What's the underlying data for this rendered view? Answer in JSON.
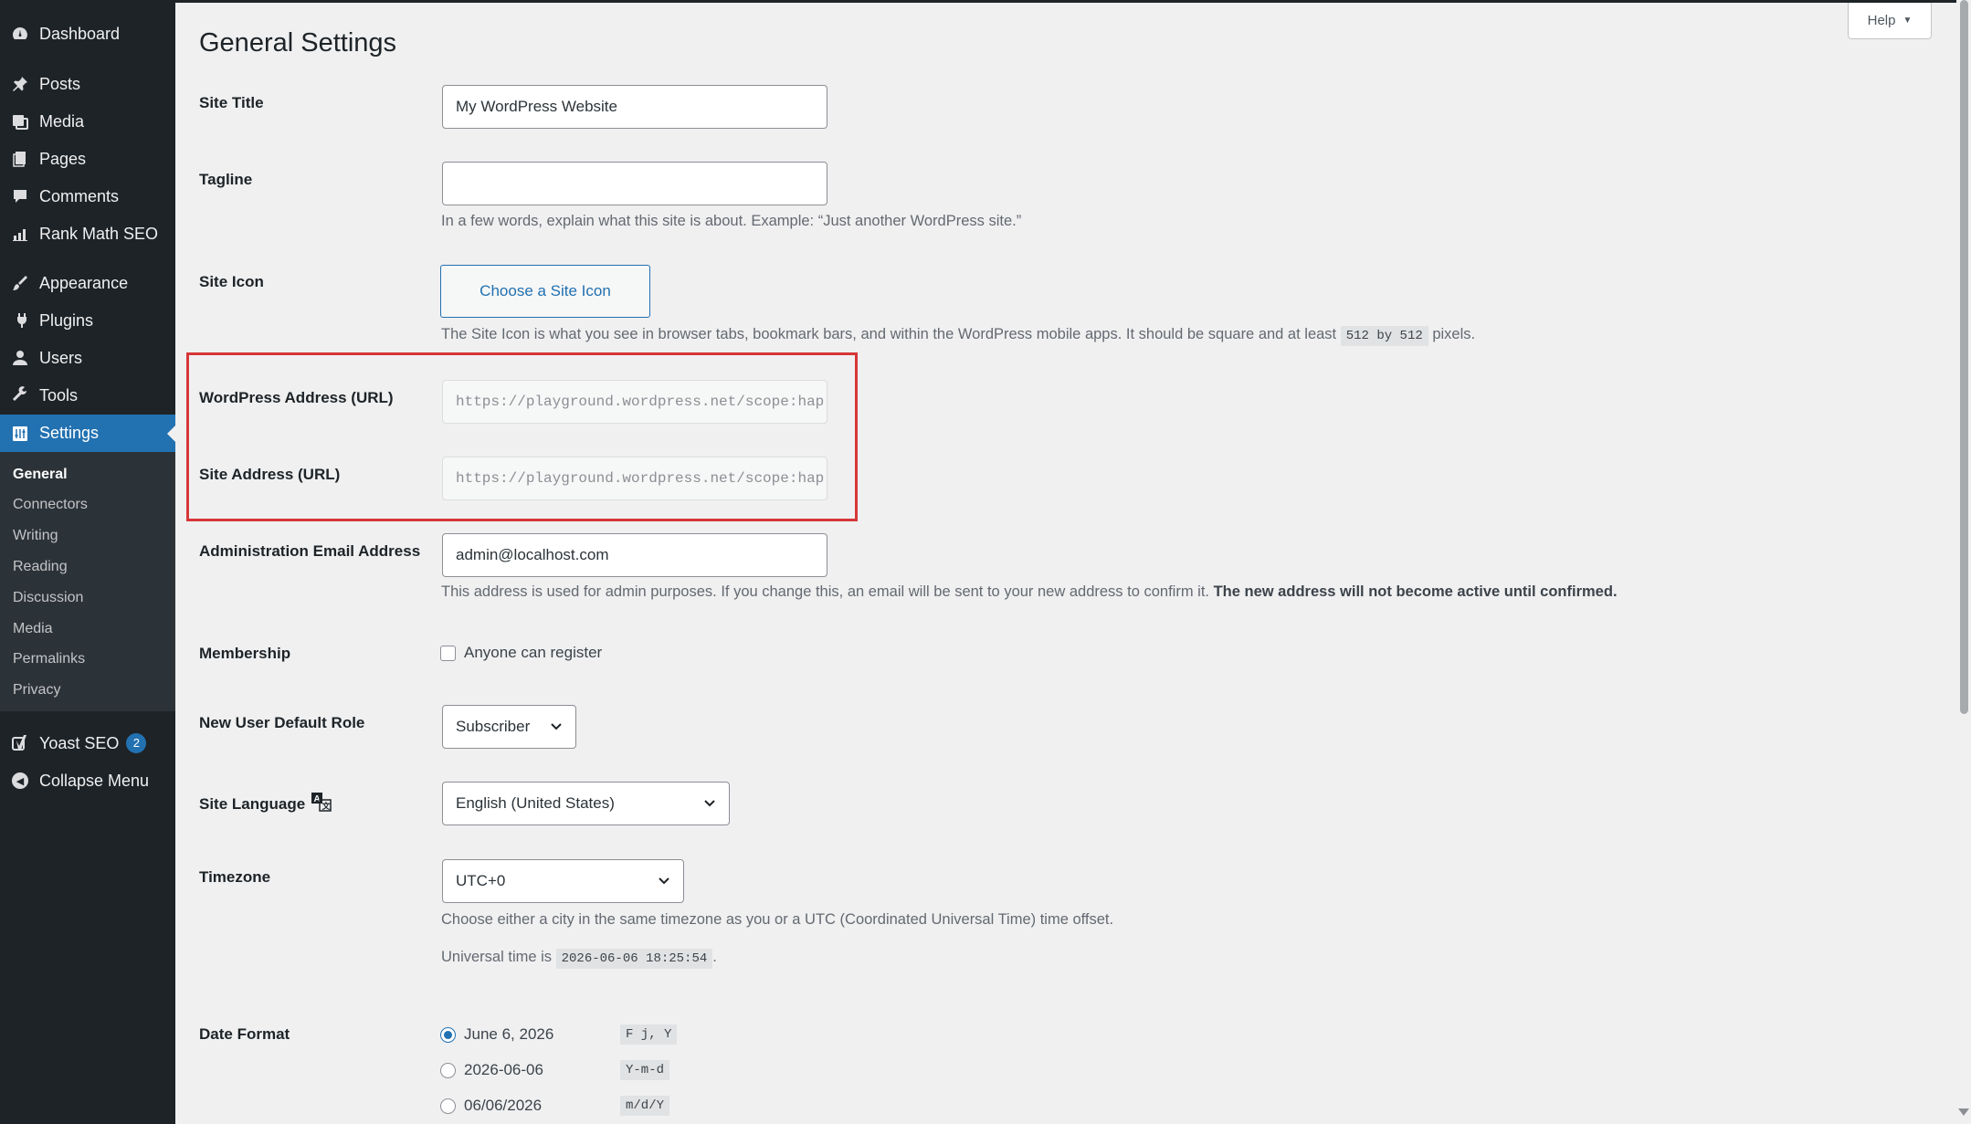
{
  "sidebar": {
    "items": [
      {
        "label": "Dashboard",
        "icon": "dashboard-icon"
      },
      {
        "label": "Posts",
        "icon": "pin-icon"
      },
      {
        "label": "Media",
        "icon": "media-icon"
      },
      {
        "label": "Pages",
        "icon": "pages-icon"
      },
      {
        "label": "Comments",
        "icon": "comment-icon"
      },
      {
        "label": "Rank Math SEO",
        "icon": "chart-icon"
      },
      {
        "label": "Appearance",
        "icon": "brush-icon"
      },
      {
        "label": "Plugins",
        "icon": "plugin-icon"
      },
      {
        "label": "Users",
        "icon": "user-icon"
      },
      {
        "label": "Tools",
        "icon": "wrench-icon"
      },
      {
        "label": "Settings",
        "icon": "settings-icon"
      }
    ],
    "submenu": [
      "General",
      "Connectors",
      "Writing",
      "Reading",
      "Discussion",
      "Media",
      "Permalinks",
      "Privacy"
    ],
    "yoast": {
      "label": "Yoast SEO",
      "badge": "2"
    },
    "collapse": "Collapse Menu"
  },
  "help": "Help",
  "page_title": "General Settings",
  "fields": {
    "site_title": {
      "label": "Site Title",
      "value": "My WordPress Website"
    },
    "tagline": {
      "label": "Tagline",
      "value": "",
      "desc": "In a few words, explain what this site is about. Example: “Just another WordPress site.”"
    },
    "site_icon": {
      "label": "Site Icon",
      "button": "Choose a Site Icon",
      "desc_pre": "The Site Icon is what you see in browser tabs, bookmark bars, and within the WordPress mobile apps. It should be square and at least",
      "desc_code": "512 by 512",
      "desc_post": "pixels."
    },
    "wp_address": {
      "label": "WordPress Address (URL)",
      "value": "https://playground.wordpress.net/scope:hap"
    },
    "site_address": {
      "label": "Site Address (URL)",
      "value": "https://playground.wordpress.net/scope:hap"
    },
    "admin_email": {
      "label": "Administration Email Address",
      "value": "admin@localhost.com",
      "desc": "This address is used for admin purposes. If you change this, an email will be sent to your new address to confirm it.",
      "desc_bold": "The new address will not become active until confirmed."
    },
    "membership": {
      "label": "Membership",
      "checkbox": "Anyone can register",
      "checked": false
    },
    "default_role": {
      "label": "New User Default Role",
      "value": "Subscriber"
    },
    "language": {
      "label": "Site Language",
      "value": "English (United States)"
    },
    "timezone": {
      "label": "Timezone",
      "value": "UTC+0",
      "desc": "Choose either a city in the same timezone as you or a UTC (Coordinated Universal Time) time offset.",
      "universal_label": "Universal time is",
      "universal_value": "2026-06-06 18:25:54"
    },
    "date_format": {
      "label": "Date Format",
      "options": [
        {
          "label": "June 6, 2026",
          "code": "F j, Y",
          "checked": true
        },
        {
          "label": "2026-06-06",
          "code": "Y-m-d",
          "checked": false
        },
        {
          "label": "06/06/2026",
          "code": "m/d/Y",
          "checked": false
        }
      ]
    }
  }
}
